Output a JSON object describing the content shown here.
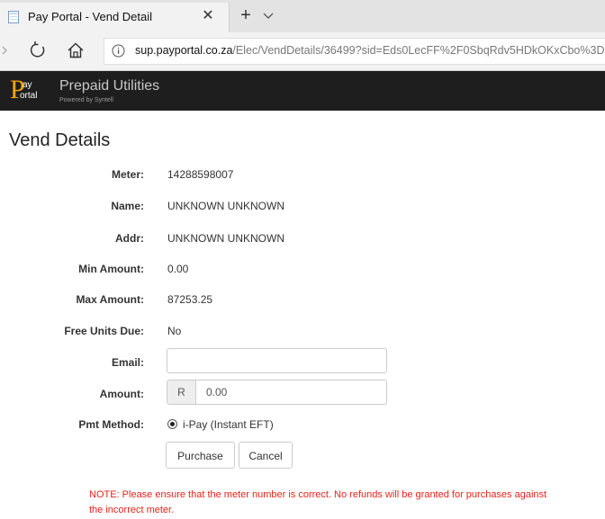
{
  "browser": {
    "tab_title": "Pay Portal - Vend Detail",
    "url_host": "sup.payportal.co.za",
    "url_path": "/Elec/VendDetails/36499?sid=Eds0LecFF%2F0SbqRdv5HDkOKxCbo%3D",
    "close_glyph": "✕",
    "new_tab_glyph": "+"
  },
  "header": {
    "logo_p": "P",
    "logo_ay": "ay",
    "logo_ortal": "ortal",
    "title": "Prepaid Utilities",
    "subtitle": "Powered by Syntell"
  },
  "page": {
    "title": "Vend Details",
    "fields": {
      "meter_label": "Meter:",
      "meter_value": "14288598007",
      "name_label": "Name:",
      "name_value": "UNKNOWN UNKNOWN",
      "addr_label": "Addr:",
      "addr_value": "UNKNOWN UNKNOWN",
      "min_label": "Min Amount:",
      "min_value": "0.00",
      "max_label": "Max Amount:",
      "max_value": "87253.25",
      "free_label": "Free Units Due:",
      "free_value": "No",
      "email_label": "Email:",
      "email_value": "",
      "amount_label": "Amount:",
      "amount_prefix": "R",
      "amount_value": "0.00",
      "pmt_label": "Pmt Method:",
      "pmt_option": "i-Pay (Instant EFT)"
    },
    "buttons": {
      "purchase": "Purchase",
      "cancel": "Cancel"
    },
    "note": "NOTE: Please ensure that the meter number is correct. No refunds will be granted for purchases against the incorrect meter."
  },
  "colors": {
    "header_bg": "#1e1e1e",
    "logo_accent": "#f5a800",
    "note_text": "#e8231b"
  }
}
